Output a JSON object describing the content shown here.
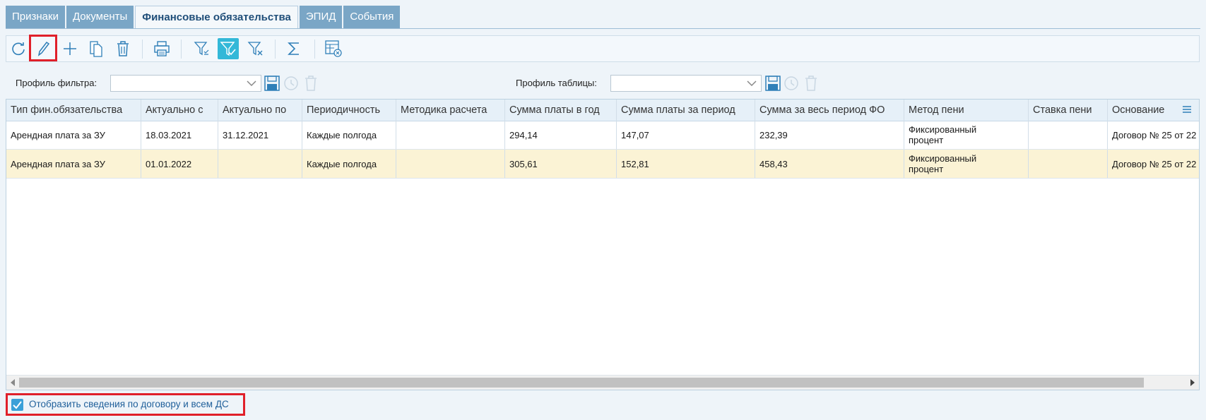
{
  "tabs": [
    {
      "label": "Признаки",
      "active": false
    },
    {
      "label": "Документы",
      "active": false
    },
    {
      "label": "Финансовые обязательства",
      "active": true
    },
    {
      "label": "ЭПИД",
      "active": false
    },
    {
      "label": "События",
      "active": false
    }
  ],
  "toolbar": {
    "buttons": [
      "refresh-icon",
      "edit-icon",
      "add-icon",
      "copy-icon",
      "delete-icon",
      "print-icon",
      "filter-icon",
      "filter-apply-icon",
      "filter-clear-icon",
      "sum-icon",
      "table-settings-icon"
    ],
    "highlight": "edit-icon",
    "accent_color": "#33b8d8"
  },
  "filter_profile": {
    "label": "Профиль фильтра:",
    "value": ""
  },
  "table_profile": {
    "label": "Профиль таблицы:",
    "value": ""
  },
  "grid": {
    "columns": [
      "Тип фин.обязательства",
      "Актуально с",
      "Актуально по",
      "Периодичность",
      "Методика расчета",
      "Сумма платы в год",
      "Сумма платы за период",
      "Сумма за весь период ФО",
      "Метод пени",
      "Ставка пени",
      "Основание"
    ],
    "rows": [
      [
        "Арендная плата за ЗУ",
        "18.03.2021",
        "31.12.2021",
        "Каждые полгода",
        "",
        "294,14",
        "147,07",
        "232,39",
        "Фиксированный процент",
        "",
        "Договор № 25 от 22"
      ],
      [
        "Арендная плата за ЗУ",
        "01.01.2022",
        "",
        "Каждые полгода",
        "",
        "305,61",
        "152,81",
        "458,43",
        "Фиксированный процент",
        "",
        "Договор № 25 от 22"
      ]
    ],
    "selected_row": 1
  },
  "checkbox": {
    "label": "Отобразить сведения по договору и всем ДС",
    "checked": true
  }
}
